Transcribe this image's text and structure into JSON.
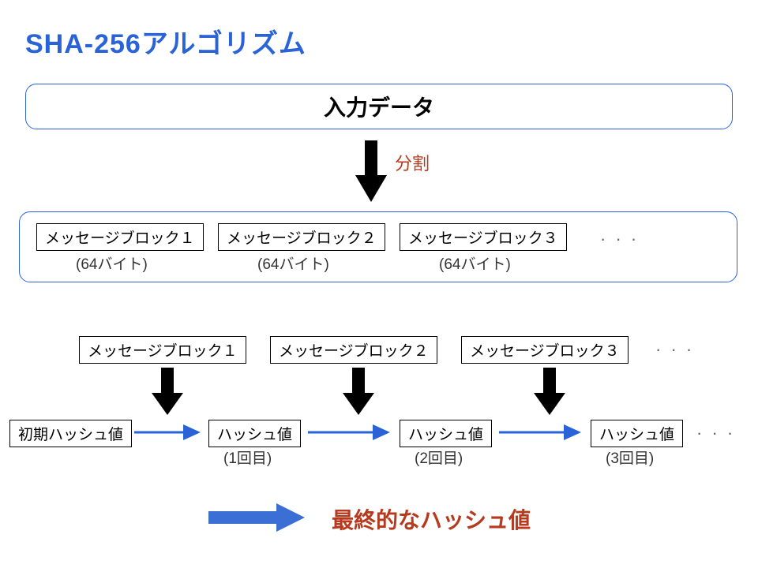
{
  "title": "SHA-256アルゴリズム",
  "input_box": "入力データ",
  "split_label": "分割",
  "blocks": {
    "b1": "メッセージブロック１",
    "b2": "メッセージブロック２",
    "b3": "メッセージブロック３",
    "size": "(64バイト)",
    "dots": "· · ·"
  },
  "chain": {
    "m1": "メッセージブロック１",
    "m2": "メッセージブロック２",
    "m3": "メッセージブロック３",
    "dots_top": "· · ·",
    "initial": "初期ハッシュ値",
    "hash": "ハッシュ値",
    "r1": "(1回目)",
    "r2": "(2回目)",
    "r3": "(3回目)",
    "dots_bottom": "· · ·"
  },
  "final": "最終的なハッシュ値"
}
